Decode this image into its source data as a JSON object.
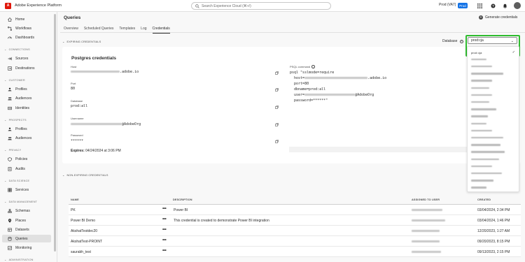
{
  "app": {
    "title": "Adobe Experience Platform",
    "logo_letter": "A"
  },
  "search": {
    "placeholder": "Search Experience Cloud (⌘+/)"
  },
  "org": {
    "name": "Prod (VA7)",
    "badge": "Prod"
  },
  "sidebar": {
    "top_items": [
      {
        "label": "Home",
        "icon": "home-icon"
      },
      {
        "label": "Workflows",
        "icon": "workflows-icon"
      },
      {
        "label": "Dashboards",
        "icon": "dashboards-icon"
      }
    ],
    "sections": [
      {
        "title": "CONNECTIONS",
        "items": [
          {
            "label": "Sources"
          },
          {
            "label": "Destinations"
          }
        ]
      },
      {
        "title": "CUSTOMER",
        "items": [
          {
            "label": "Profiles"
          },
          {
            "label": "Audiences"
          },
          {
            "label": "Identities"
          }
        ]
      },
      {
        "title": "PROSPECTS",
        "items": [
          {
            "label": "Profiles"
          },
          {
            "label": "Audiences"
          }
        ]
      },
      {
        "title": "PRIVACY",
        "items": [
          {
            "label": "Policies"
          },
          {
            "label": "Audits"
          }
        ]
      },
      {
        "title": "DATA SCIENCE",
        "items": [
          {
            "label": "Services"
          }
        ]
      },
      {
        "title": "DATA MANAGEMENT",
        "items": [
          {
            "label": "Schemas"
          },
          {
            "label": "Places"
          },
          {
            "label": "Datasets"
          },
          {
            "label": "Queries",
            "active": true
          },
          {
            "label": "Monitoring"
          }
        ]
      },
      {
        "title": "ADMINISTRATION",
        "items": []
      }
    ]
  },
  "page": {
    "title": "Queries",
    "generate_button": "Generate credentials",
    "tabs": [
      "Overview",
      "Scheduled Queries",
      "Templates",
      "Log",
      "Credentials"
    ],
    "active_tab": "Credentials"
  },
  "expiring": {
    "section_label": "EXPIRING CREDENTIALS",
    "database_label": "Database",
    "database_value": "prod:cja",
    "card_title": "Postgres credentials",
    "fields": [
      {
        "label": "Host",
        "value_suffix": ".adobe.io"
      },
      {
        "label": "Port",
        "value": "80"
      },
      {
        "label": "Database",
        "value": "prod:all"
      },
      {
        "label": "Username",
        "value_suffix": "@AdobeOrg"
      },
      {
        "label": "Password",
        "value": "******"
      }
    ],
    "expires_label": "Expires:",
    "expires_value": "04/24/2024 at 3:06 PM",
    "psql_label": "PSQL command",
    "psql_lines": [
      "psql \"sslmode=require",
      "  host=",
      "  port=80",
      "  dbname=prod:all",
      "  user=",
      "  password=******\""
    ],
    "psql_host_suffix": ".adobe.io",
    "psql_user_suffix": "@AdobeOrg"
  },
  "non_expiring": {
    "section_label": "NON-EXPIRING CREDENTIALS",
    "columns": [
      "NAME",
      "DESCRIPTION",
      "ASSIGNED TO USER",
      "CREATED"
    ],
    "rows": [
      {
        "name": "PK",
        "description": "Power BI",
        "created": "03/04/2024, 2:34 PM"
      },
      {
        "name": "Power BI Demo",
        "description": "This credential is created to demonstrate Power BI integration",
        "created": "03/04/2024, 1:46 PM"
      },
      {
        "name": "AkshatTestdec20",
        "description": "",
        "created": "12/20/2023, 1:27 AM"
      },
      {
        "name": "AkshatTest-PROINT",
        "description": "",
        "created": "09/20/2023, 8:15 PM"
      },
      {
        "name": "saurabh_test",
        "description": "",
        "created": "09/13/2023, 2:15 PM"
      }
    ]
  },
  "dropdown": {
    "options_first": "prod::cja",
    "selected_check": "✓",
    "redacted_option_count": 19
  },
  "colors": {
    "accent": "#1473e6",
    "highlight": "#2fbc2f",
    "brand": "#e0180c"
  }
}
